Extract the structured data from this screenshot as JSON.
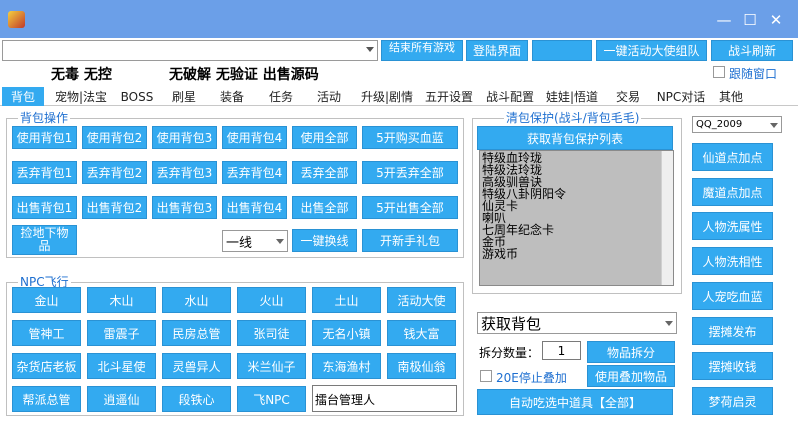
{
  "window": {
    "icon": "game-app-icon",
    "minimize": "—",
    "maximize": "☐",
    "close": "✕"
  },
  "toolbar": {
    "top_combo_value": "",
    "end_all_games": "结束所有游戏",
    "login_screen": "登陆界面",
    "blank_button": "",
    "one_key_team": "一键活动大使组队",
    "refresh_battle": "战斗刷新",
    "follow_window": "跟随窗口"
  },
  "slogans": [
    "无毒 无控",
    "无破解 无验证  出售源码"
  ],
  "tabs": [
    "背包",
    "宠物|法宝",
    "BOSS",
    "刷星",
    "装备",
    "任务",
    "活动",
    "升级|剧情",
    "五开设置",
    "战斗配置",
    "娃娃|悟道",
    "交易",
    "NPC对话",
    "其他"
  ],
  "bag": {
    "title": "背包操作",
    "row1": [
      "使用背包1",
      "使用背包2",
      "使用背包3",
      "使用背包4",
      "使用全部",
      "5开购买血蓝"
    ],
    "row2": [
      "丢弃背包1",
      "丢弃背包2",
      "丢弃背包3",
      "丢弃背包4",
      "丢弃全部",
      "5开丢弃全部"
    ],
    "row3": [
      "出售背包1",
      "出售背包2",
      "出售背包3",
      "出售背包4",
      "出售全部",
      "5开出售全部"
    ],
    "pickup": "捡地下物品",
    "line_select": "一线",
    "one_key_switch_line": "一键换线",
    "open_gift": "开新手礼包"
  },
  "npc": {
    "title": "NPC飞行",
    "row1": [
      "金山",
      "木山",
      "水山",
      "火山",
      "土山",
      "活动大使"
    ],
    "row2": [
      "管神工",
      "雷震子",
      "民房总管",
      "张司徒",
      "无名小镇",
      "钱大富"
    ],
    "row3": [
      "杂货店老板",
      "北斗星使",
      "灵兽异人",
      "米兰仙子",
      "东海渔村",
      "南极仙翁"
    ],
    "row4": [
      "帮派总管",
      "逍遥仙",
      "段铁心",
      "飞NPC"
    ],
    "target_input": "擂台管理人"
  },
  "protect": {
    "title": "清包保护(战斗/背包毛毛)",
    "get_list": "获取背包保护列表",
    "items": [
      "特级血玲珑",
      "特级法玲珑",
      "高级驯兽诀",
      "特级八卦阴阳令",
      "仙灵卡",
      "喇叭",
      "七周年纪念卡",
      "金币",
      "游戏币"
    ],
    "bag_select": "获取背包",
    "split_label": "拆分数量：",
    "split_value": "1",
    "split_button": "物品拆分",
    "stop_stack": "20E停止叠加",
    "use_stack": "使用叠加物品",
    "auto_eat": "自动吃选中道具【全部】"
  },
  "right": {
    "account": "QQ_2009",
    "buttons": [
      "仙道点加点",
      "魔道点加点",
      "人物洗属性",
      "人物洗相性",
      "人宠吃血蓝",
      "摆摊发布",
      "摆摊收钱",
      "梦荷启灵"
    ]
  }
}
